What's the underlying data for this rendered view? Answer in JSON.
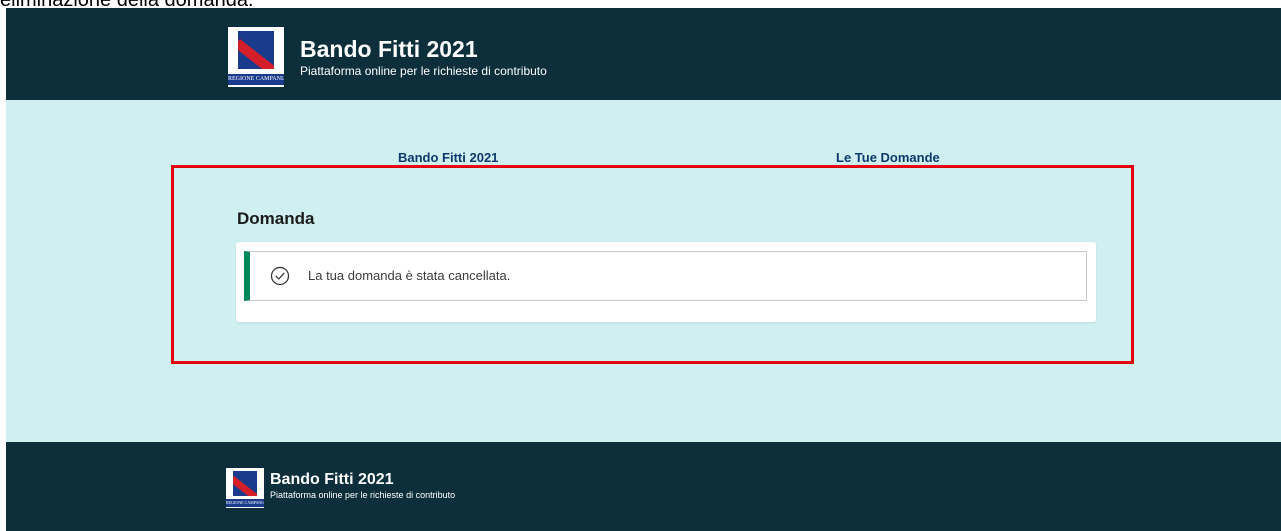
{
  "caption": "eliminazione della domanda.",
  "header": {
    "logo_text": "REGIONE CAMPANIA",
    "title": "Bando Fitti 2021",
    "subtitle": "Piattaforma online per le richieste di contributo"
  },
  "nav": {
    "bando_label": "Bando Fitti 2021",
    "domande_label": "Le Tue Domande"
  },
  "section": {
    "title": "Domanda"
  },
  "alert": {
    "icon": "check-circle-icon",
    "message": "La tua domanda è stata cancellata."
  },
  "footer": {
    "logo_text": "REGIONE CAMPANIA",
    "title": "Bando Fitti 2021",
    "subtitle": "Piattaforma online per le richieste di contributo"
  },
  "colors": {
    "header_bg": "#0d2f3b",
    "page_bg": "#cfeff0",
    "link": "#0d3a6e",
    "highlight": "#e3000f",
    "success": "#008758"
  }
}
